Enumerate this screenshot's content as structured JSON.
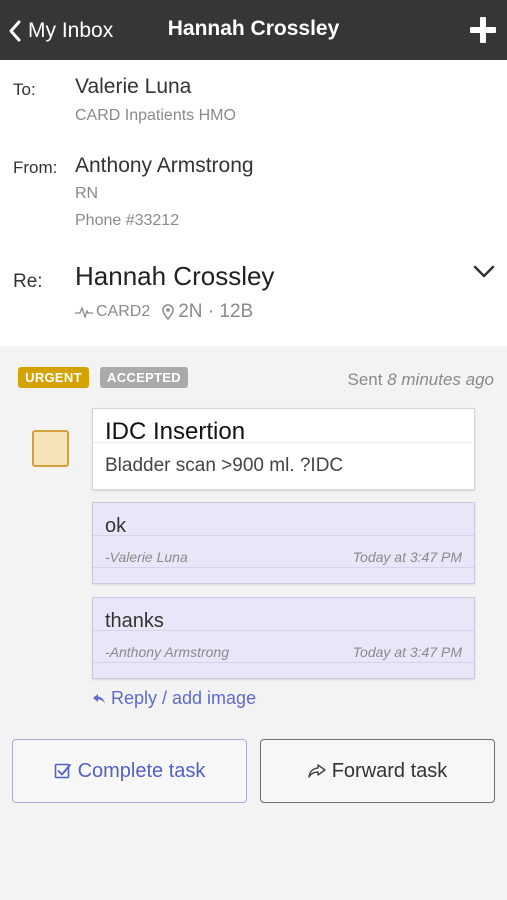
{
  "nav": {
    "back_label": "My Inbox",
    "title": "Hannah Crossley"
  },
  "to": {
    "label": "To:",
    "name": "Valerie Luna",
    "team": "CARD Inpatients HMO"
  },
  "from": {
    "label": "From:",
    "name": "Anthony Armstrong",
    "role": "RN",
    "phone": "Phone #33212"
  },
  "re": {
    "label": "Re:",
    "patient": "Hannah Crossley",
    "ward": "CARD2",
    "location": "2N · 12B"
  },
  "status": {
    "urgent": "URGENT",
    "accepted": "ACCEPTED",
    "sent_prefix": "Sent",
    "sent_ago": "8 minutes ago"
  },
  "task": {
    "title": "IDC Insertion",
    "body": "Bladder scan >900 ml. ?IDC"
  },
  "messages": [
    {
      "text": "ok",
      "author": "-Valerie Luna",
      "time": "Today at 3:47 PM"
    },
    {
      "text": "thanks",
      "author": "-Anthony Armstrong",
      "time": "Today at 3:47 PM"
    }
  ],
  "reply_label": "Reply / add image",
  "actions": {
    "complete": "Complete task",
    "forward": "Forward task"
  },
  "colors": {
    "navbar": "#363636",
    "urgent": "#d5a300",
    "accepted": "#aaaaaa",
    "accent": "#5e6ad1",
    "message_bg": "#e7e7f9"
  },
  "icons": {
    "back": "chevron-left-icon",
    "new": "plus-icon",
    "expand": "chevron-down-icon",
    "ward": "heartbeat-icon",
    "location": "map-pin-icon",
    "reply": "reply-arrow-icon",
    "complete": "checkbox-icon",
    "forward": "forward-arrow-icon"
  }
}
